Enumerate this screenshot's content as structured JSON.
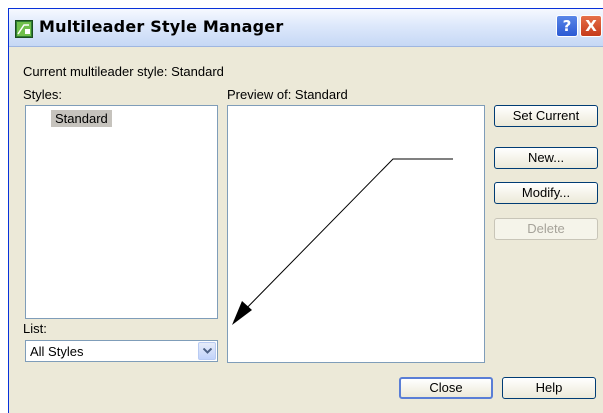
{
  "window": {
    "title": "Multileader Style Manager",
    "help_glyph": "?",
    "close_glyph": "X"
  },
  "current_style_label": "Current multileader style: Standard",
  "styles": {
    "label": "Styles:",
    "items": [
      "Standard"
    ],
    "selected": "Standard"
  },
  "preview": {
    "label": "Preview of: Standard"
  },
  "list": {
    "label": "List:",
    "selected": "All Styles"
  },
  "buttons": {
    "set_current": "Set Current",
    "new": "New...",
    "modify": "Modify...",
    "delete": "Delete",
    "close": "Close",
    "help": "Help"
  },
  "colors": {
    "selection": "#c6c3bd",
    "dialog_bg": "#ece9d8",
    "disabled_text": "#a6a39a"
  },
  "icons": {
    "app": "autocad-multileader-icon",
    "combo": "chevron-down-icon"
  }
}
